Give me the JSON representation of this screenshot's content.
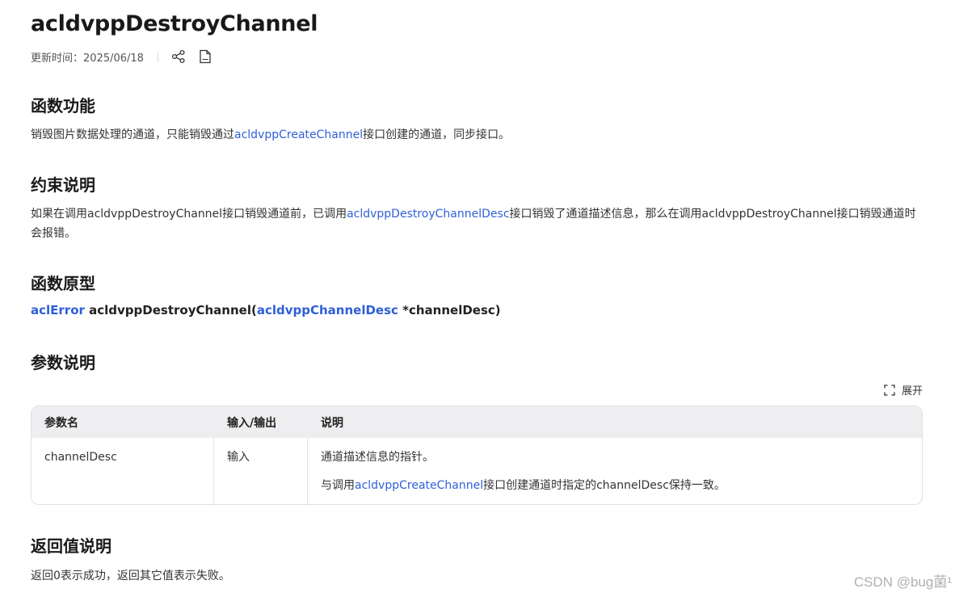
{
  "page": {
    "title": "acldvppDestroyChannel",
    "updated": "更新时间：2025/06/18"
  },
  "sections": {
    "function": {
      "heading": "函数功能",
      "text_before": "销毁图片数据处理的通道，只能销毁通过",
      "link": "acldvppCreateChannel",
      "text_after": "接口创建的通道，同步接口。"
    },
    "constraints": {
      "heading": "约束说明",
      "text_before": "如果在调用acldvppDestroyChannel接口销毁通道前，已调用",
      "link": "acldvppDestroyChannelDesc",
      "text_after": "接口销毁了通道描述信息，那么在调用acldvppDestroyChannel接口销毁通道时会报错。"
    },
    "prototype": {
      "heading": "函数原型",
      "ret_type": "aclError",
      "func": " acldvppDestroyChannel(",
      "param_type": "acldvppChannelDesc",
      "param": " *channelDesc)"
    },
    "params": {
      "heading": "参数说明",
      "expand_label": "展开",
      "columns": [
        "参数名",
        "输入/输出",
        "说明"
      ],
      "rows": [
        {
          "name": "channelDesc",
          "io": "输入",
          "desc1": "通道描述信息的指针。",
          "desc2_before": "与调用",
          "desc2_link": "acldvppCreateChannel",
          "desc2_after": "接口创建通道时指定的channelDesc保持一致。"
        }
      ]
    },
    "return": {
      "heading": "返回值说明",
      "text": "返回0表示成功，返回其它值表示失败。"
    }
  },
  "watermark": "CSDN @bug菌¹",
  "colors": {
    "link": "#2e5fd8",
    "header_bg": "#eeeef0"
  },
  "icons": [
    "share-icon",
    "pdf-icon",
    "expand-icon"
  ]
}
